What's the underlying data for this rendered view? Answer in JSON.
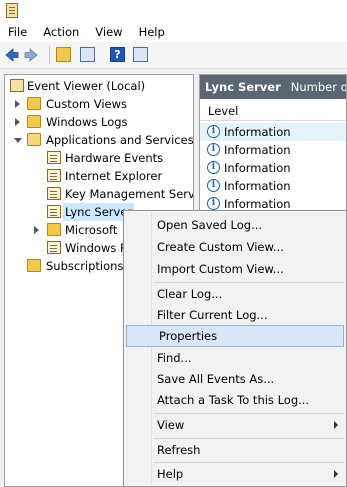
{
  "menubar": {
    "items": [
      "File",
      "Action",
      "View",
      "Help"
    ]
  },
  "toolbar": {
    "help_glyph": "?"
  },
  "tree": {
    "items": [
      {
        "label": "Event Viewer (Local)"
      },
      {
        "label": "Custom Views"
      },
      {
        "label": "Windows Logs"
      },
      {
        "label": "Applications and Services Lo"
      },
      {
        "label": "Hardware Events"
      },
      {
        "label": "Internet Explorer"
      },
      {
        "label": "Key Management Service"
      },
      {
        "label": "Lync Server"
      },
      {
        "label": "Microsoft"
      },
      {
        "label": "Windows P"
      },
      {
        "label": "Subscriptions"
      }
    ]
  },
  "right_pane": {
    "title": "Lync Server",
    "subtitle": "Number of e",
    "column_header": "Level",
    "rows": [
      "Information",
      "Information",
      "Information",
      "Information",
      "Information"
    ]
  },
  "context_menu": {
    "items": [
      {
        "label": "Open Saved Log..."
      },
      {
        "label": "Create Custom View..."
      },
      {
        "label": "Import Custom View..."
      },
      {
        "label": "Clear Log..."
      },
      {
        "label": "Filter Current Log..."
      },
      {
        "label": "Properties"
      },
      {
        "label": "Find..."
      },
      {
        "label": "Save All Events As..."
      },
      {
        "label": "Attach a Task To this Log..."
      },
      {
        "label": "View"
      },
      {
        "label": "Refresh"
      },
      {
        "label": "Help"
      }
    ],
    "highlight_color": "#d8e6f5"
  },
  "colors": {
    "header_bg": "#5a6672",
    "selection": "#cce8ff",
    "info_blue": "#1a5fb4"
  }
}
